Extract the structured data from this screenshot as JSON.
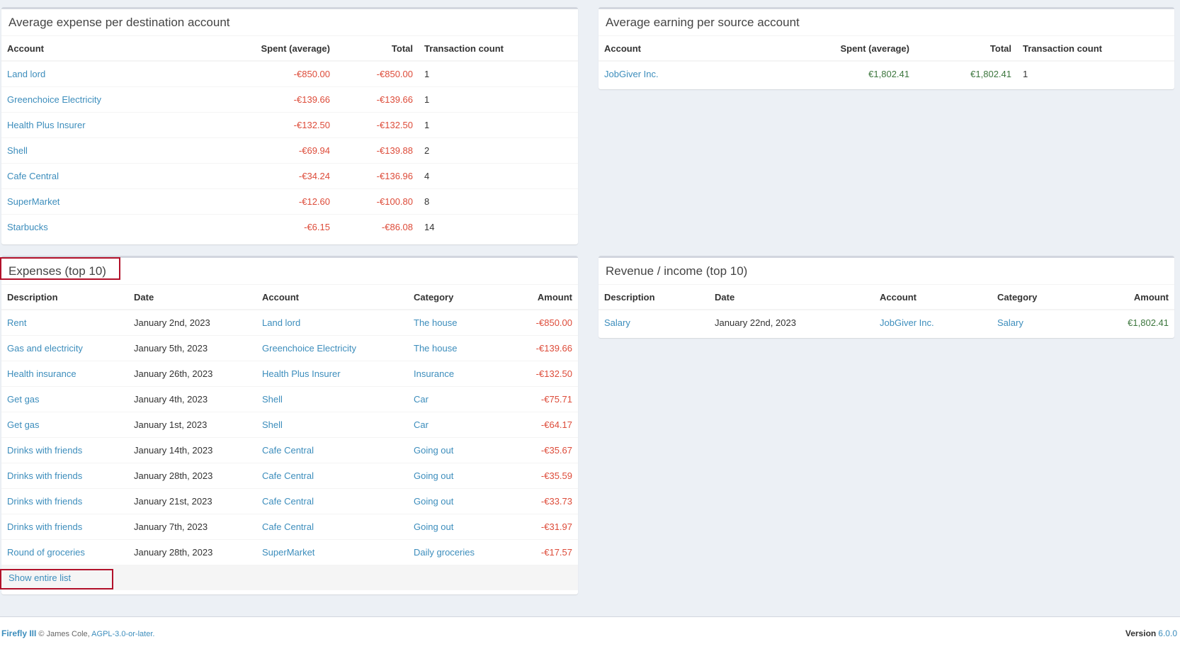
{
  "expense_per_dest": {
    "title": "Average expense per destination account",
    "headers": [
      "Account",
      "Spent (average)",
      "Total",
      "Transaction count"
    ],
    "rows": [
      {
        "account": "Land lord",
        "avg": "-€850.00",
        "total": "-€850.00",
        "count": "1"
      },
      {
        "account": "Greenchoice Electricity",
        "avg": "-€139.66",
        "total": "-€139.66",
        "count": "1"
      },
      {
        "account": "Health Plus Insurer",
        "avg": "-€132.50",
        "total": "-€132.50",
        "count": "1"
      },
      {
        "account": "Shell",
        "avg": "-€69.94",
        "total": "-€139.88",
        "count": "2"
      },
      {
        "account": "Cafe Central",
        "avg": "-€34.24",
        "total": "-€136.96",
        "count": "4"
      },
      {
        "account": "SuperMarket",
        "avg": "-€12.60",
        "total": "-€100.80",
        "count": "8"
      },
      {
        "account": "Starbucks",
        "avg": "-€6.15",
        "total": "-€86.08",
        "count": "14"
      }
    ]
  },
  "earning_per_source": {
    "title": "Average earning per source account",
    "headers": [
      "Account",
      "Spent (average)",
      "Total",
      "Transaction count"
    ],
    "rows": [
      {
        "account": "JobGiver Inc.",
        "avg": "€1,802.41",
        "total": "€1,802.41",
        "count": "1"
      }
    ]
  },
  "expenses_top": {
    "title": "Expenses (top 10)",
    "headers": [
      "Description",
      "Date",
      "Account",
      "Category",
      "Amount"
    ],
    "rows": [
      {
        "desc": "Rent",
        "date": "January 2nd, 2023",
        "account": "Land lord",
        "category": "The house",
        "amount": "-€850.00"
      },
      {
        "desc": "Gas and electricity",
        "date": "January 5th, 2023",
        "account": "Greenchoice Electricity",
        "category": "The house",
        "amount": "-€139.66"
      },
      {
        "desc": "Health insurance",
        "date": "January 26th, 2023",
        "account": "Health Plus Insurer",
        "category": "Insurance",
        "amount": "-€132.50"
      },
      {
        "desc": "Get gas",
        "date": "January 4th, 2023",
        "account": "Shell",
        "category": "Car",
        "amount": "-€75.71"
      },
      {
        "desc": "Get gas",
        "date": "January 1st, 2023",
        "account": "Shell",
        "category": "Car",
        "amount": "-€64.17"
      },
      {
        "desc": "Drinks with friends",
        "date": "January 14th, 2023",
        "account": "Cafe Central",
        "category": "Going out",
        "amount": "-€35.67"
      },
      {
        "desc": "Drinks with friends",
        "date": "January 28th, 2023",
        "account": "Cafe Central",
        "category": "Going out",
        "amount": "-€35.59"
      },
      {
        "desc": "Drinks with friends",
        "date": "January 21st, 2023",
        "account": "Cafe Central",
        "category": "Going out",
        "amount": "-€33.73"
      },
      {
        "desc": "Drinks with friends",
        "date": "January 7th, 2023",
        "account": "Cafe Central",
        "category": "Going out",
        "amount": "-€31.97"
      },
      {
        "desc": "Round of groceries",
        "date": "January 28th, 2023",
        "account": "SuperMarket",
        "category": "Daily groceries",
        "amount": "-€17.57"
      }
    ],
    "show_all_label": "Show entire list"
  },
  "revenue_top": {
    "title": "Revenue / income (top 10)",
    "headers": [
      "Description",
      "Date",
      "Account",
      "Category",
      "Amount"
    ],
    "rows": [
      {
        "desc": "Salary",
        "date": "January 22nd, 2023",
        "account": "JobGiver Inc.",
        "category": "Salary",
        "amount": "€1,802.41"
      }
    ]
  },
  "footer": {
    "brand": "Firefly III",
    "copyright": "© James Cole,",
    "license": "AGPL-3.0-or-later.",
    "version_label": "Version",
    "version": "6.0.0"
  },
  "colors": {
    "negative": "#dd4b39",
    "positive": "#00a65a",
    "link": "#3c8dbc",
    "highlight": "#b2112a"
  }
}
